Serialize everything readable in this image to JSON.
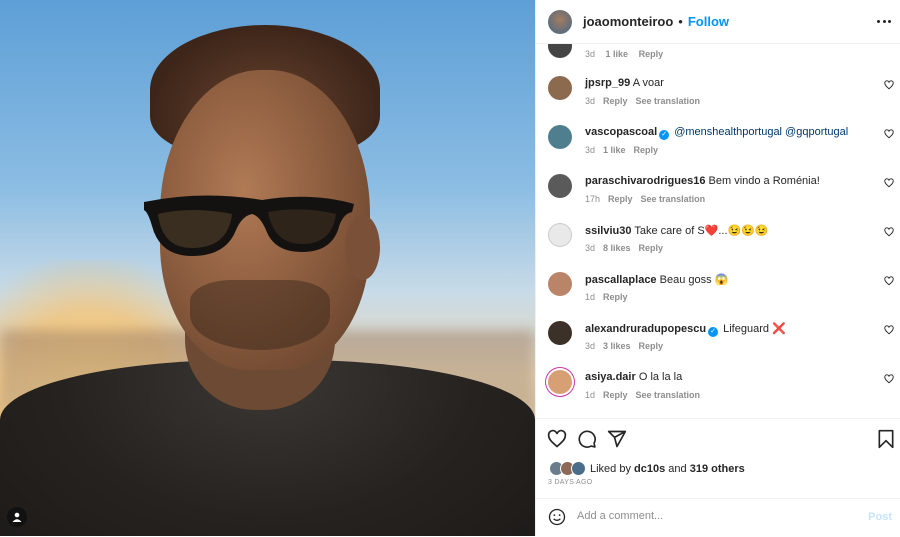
{
  "header": {
    "username": "joaomonteiroo",
    "dot": "•",
    "follow_label": "Follow"
  },
  "partial_comment": {
    "time": "3d",
    "likes": "1 like",
    "reply": "Reply"
  },
  "comments": [
    {
      "user": "jpsrp_99",
      "text": "A voar",
      "time": "3d",
      "likes": "",
      "reply": "Reply",
      "translate": "See translation",
      "avatar_color": "#8b6a4e"
    },
    {
      "user": "vascopascoal",
      "verified": true,
      "text": "@menshealthportugal @gqportugal",
      "time": "3d",
      "likes": "1 like",
      "reply": "Reply",
      "translate": "",
      "avatar_color": "#4f7f8f"
    },
    {
      "user": "paraschivarodrigues16",
      "text": "Bem vindo a Roménia!",
      "time": "17h",
      "likes": "",
      "reply": "Reply",
      "translate": "See translation",
      "avatar_color": "#5a5a5a"
    },
    {
      "user": "ssilviu30",
      "text": "Take care of S❤️...😉😉😉",
      "time": "3d",
      "likes": "8 likes",
      "reply": "Reply",
      "translate": "",
      "avatar_color": "#e9e9e9"
    },
    {
      "user": "pascallaplace",
      "text": "Beau goss 😱",
      "time": "1d",
      "likes": "",
      "reply": "Reply",
      "translate": "",
      "avatar_color": "#b98467"
    },
    {
      "user": "alexandruradupopescu",
      "verified": true,
      "text": "Lifeguard ❌",
      "time": "3d",
      "likes": "3 likes",
      "reply": "Reply",
      "translate": "",
      "avatar_color": "#3c3128"
    },
    {
      "user": "asiya.dair",
      "text": "O la la la",
      "time": "1d",
      "likes": "",
      "reply": "Reply",
      "translate": "See translation",
      "avatar_color": "#d6a074"
    }
  ],
  "liked_by": {
    "prefix": "Liked by ",
    "user": "dc10s",
    "middle": " and ",
    "others": "319 others"
  },
  "post_date": "3 DAYS AGO",
  "add_comment": {
    "placeholder": "Add a comment...",
    "post_label": "Post"
  },
  "colors": {
    "accent": "#0095f6",
    "text": "#262626",
    "muted": "#8e8e8e"
  },
  "icons": [
    "heart-icon",
    "comment-icon",
    "share-icon",
    "bookmark-icon",
    "emoji-icon",
    "more-icon",
    "verified-icon",
    "camera-icon"
  ]
}
